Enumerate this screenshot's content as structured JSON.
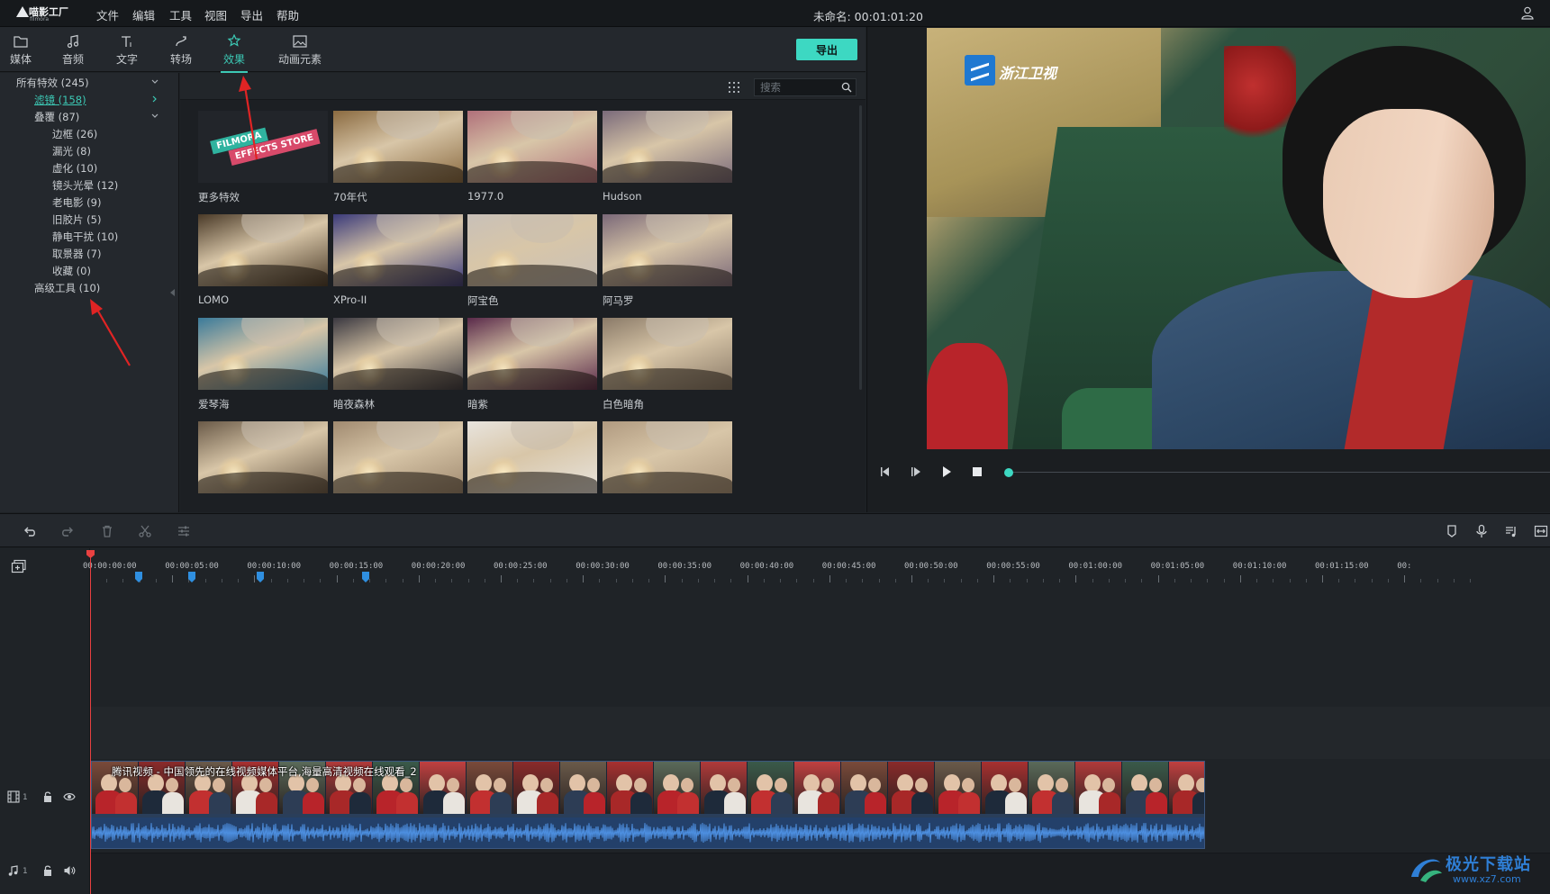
{
  "app": {
    "logo_name": "喵影工厂",
    "logo_sub": "filmora",
    "project_title": "未命名: 00:01:01:20"
  },
  "menu": [
    "文件",
    "编辑",
    "工具",
    "视图",
    "导出",
    "帮助"
  ],
  "tabs": [
    {
      "label": "媒体",
      "icon": "folder-icon"
    },
    {
      "label": "音频",
      "icon": "music-note-icon"
    },
    {
      "label": "文字",
      "icon": "text-icon"
    },
    {
      "label": "转场",
      "icon": "transition-icon"
    },
    {
      "label": "效果",
      "icon": "effects-icon",
      "active": true
    },
    {
      "label": "动画元素",
      "icon": "image-icon"
    }
  ],
  "export_label": "导出",
  "tree": {
    "all": "所有特效 (245)",
    "filter": "滤镜 (158)",
    "overlay": "叠覆 (87)",
    "overlay_children": [
      "边框 (26)",
      "漏光 (8)",
      "虚化 (10)",
      "镜头光晕 (12)",
      "老电影 (9)",
      "旧胶片 (5)",
      "静电干扰 (10)",
      "取景器 (7)",
      "收藏 (0)"
    ],
    "advanced": "高级工具 (10)"
  },
  "search": {
    "placeholder": "搜索"
  },
  "store_banner": {
    "line1": "FILMORA",
    "line2": "EFFECTS STORE"
  },
  "effects": [
    {
      "name": "更多特效",
      "tint": "store"
    },
    {
      "name": "70年代",
      "tint": "#8a6a40"
    },
    {
      "name": "1977.0",
      "tint": "#b0707a"
    },
    {
      "name": "Hudson",
      "tint": "#7a6a7a"
    },
    {
      "name": "LOMO",
      "tint": "#4a3a28"
    },
    {
      "name": "XPro-II",
      "tint": "#3a3a7a"
    },
    {
      "name": "阿宝色",
      "tint": "#c8c0b8"
    },
    {
      "name": "阿马罗",
      "tint": "#7a6878"
    },
    {
      "name": "爱琴海",
      "tint": "#3a7a9a"
    },
    {
      "name": "暗夜森林",
      "tint": "#3a3840"
    },
    {
      "name": "暗紫",
      "tint": "#5a2a4a"
    },
    {
      "name": "白色暗角",
      "tint": "#8a7a68"
    },
    {
      "name": "",
      "tint": "#6a5a48"
    },
    {
      "name": "",
      "tint": "#a08a70"
    },
    {
      "name": "",
      "tint": "#e8e4de"
    },
    {
      "name": "",
      "tint": "#b09a80"
    }
  ],
  "preview": {
    "channel_logo": "浙江卫视",
    "progress": 0
  },
  "timeline": {
    "ticks": [
      "00:00:00:00",
      "00:00:05:00",
      "00:00:10:00",
      "00:00:15:00",
      "00:00:20:00",
      "00:00:25:00",
      "00:00:30:00",
      "00:00:35:00",
      "00:00:40:00",
      "00:00:45:00",
      "00:00:50:00",
      "00:00:55:00",
      "00:01:00:00",
      "00:01:05:00",
      "00:01:10:00",
      "00:01:15:00",
      "00:"
    ],
    "clip_title": "腾讯视频 - 中国领先的在线视频媒体平台,海量高清视频在线观看_2",
    "video_track_num": "1",
    "audio_track_num": "1"
  },
  "watermark": {
    "title": "极光下载站",
    "url": "www.xz7.com"
  },
  "colors": {
    "accent": "#3dd8c2",
    "playhead": "#e84141",
    "annotation": "#e02424"
  }
}
